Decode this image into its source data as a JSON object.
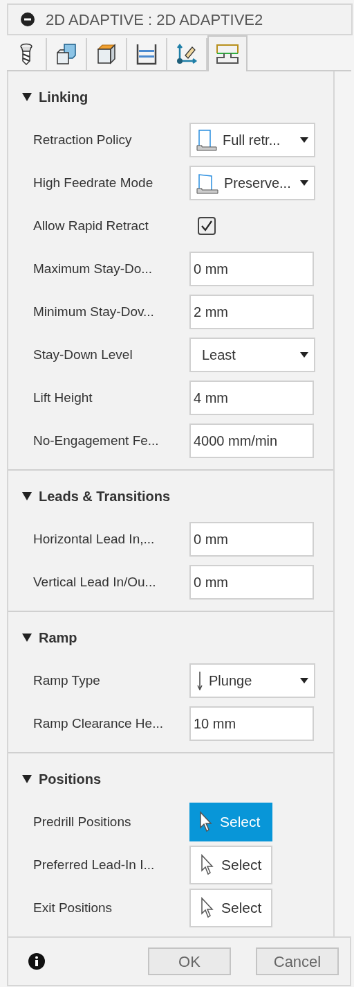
{
  "window": {
    "title": "2D ADAPTIVE : 2D ADAPTIVE2"
  },
  "tabs": [
    {
      "selected": false
    },
    {
      "selected": false
    },
    {
      "selected": false
    },
    {
      "selected": false
    },
    {
      "selected": false
    },
    {
      "selected": true
    }
  ],
  "sections": [
    {
      "title": "Linking",
      "expanded": true,
      "rows": [
        {
          "kind": "dropdown",
          "label": "Retraction Policy",
          "value": "Full retr..."
        },
        {
          "kind": "dropdown",
          "label": "High Feedrate Mode",
          "value": "Preserve..."
        },
        {
          "kind": "checkbox",
          "label": "Allow Rapid Retract",
          "checked": true
        },
        {
          "kind": "field",
          "label": "Maximum Stay-Do...",
          "value": "0 mm"
        },
        {
          "kind": "field",
          "label": "Minimum Stay-Dov...",
          "value": "2 mm"
        },
        {
          "kind": "dropdown",
          "label": "Stay-Down Level",
          "value": "Least"
        },
        {
          "kind": "field",
          "label": "Lift Height",
          "value": "4 mm"
        },
        {
          "kind": "field",
          "label": "No-Engagement Fe...",
          "value": "4000 mm/min"
        }
      ]
    },
    {
      "title": "Leads & Transitions",
      "expanded": true,
      "rows": [
        {
          "kind": "field",
          "label": "Horizontal Lead In,...",
          "value": "0 mm"
        },
        {
          "kind": "field",
          "label": "Vertical Lead In/Ou...",
          "value": "0 mm"
        }
      ]
    },
    {
      "title": "Ramp",
      "expanded": true,
      "rows": [
        {
          "kind": "dropdown",
          "label": "Ramp Type",
          "value": "Plunge"
        },
        {
          "kind": "field",
          "label": "Ramp Clearance He...",
          "value": "10 mm"
        }
      ]
    },
    {
      "title": "Positions",
      "expanded": true,
      "rows": [
        {
          "kind": "select",
          "label": "Predrill Positions",
          "value": "Select",
          "selected": true
        },
        {
          "kind": "select",
          "label": "Preferred Lead-In I...",
          "value": "Select",
          "selected": false
        },
        {
          "kind": "select",
          "label": "Exit Positions",
          "value": "Select",
          "selected": false
        }
      ]
    }
  ],
  "footer": {
    "buttons": [
      "OK",
      "Cancel"
    ]
  }
}
